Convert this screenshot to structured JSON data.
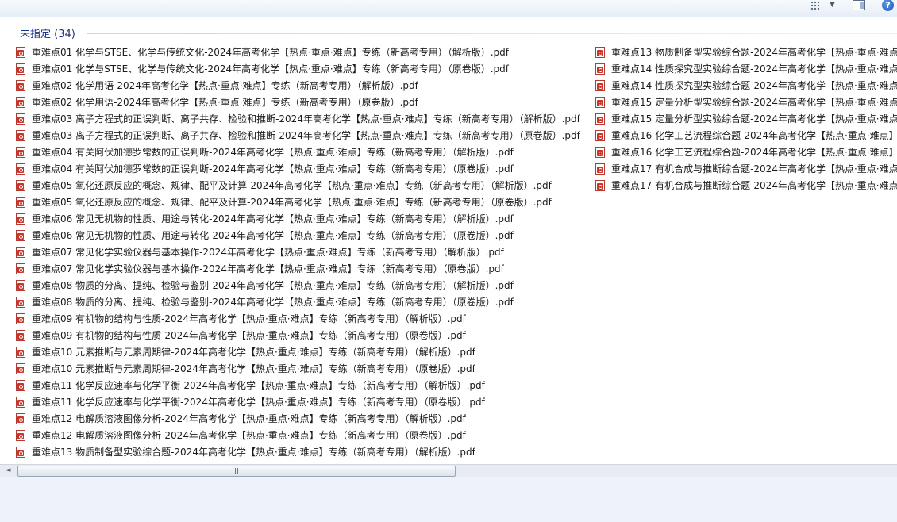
{
  "group": {
    "label": "未指定 (34)"
  },
  "colors": {
    "group_header": "#1e3287",
    "pdf_red": "#c9342b"
  },
  "icons": {
    "view": "view-options-icon",
    "chevron": "chevron-down-icon",
    "pane": "preview-pane-icon",
    "help": "help-icon",
    "file": "pdf-file-icon"
  },
  "toolbar": {
    "chevron_glyph": "▼",
    "help_glyph": "?"
  },
  "scroll": {
    "left_arrow": "◄"
  },
  "files_col1": [
    "重难点01 化学与STSE、化学与传统文化-2024年高考化学【热点·重点·难点】专练（新高考专用）（解析版）.pdf",
    "重难点01 化学与STSE、化学与传统文化-2024年高考化学【热点·重点·难点】专练（新高考专用）（原卷版）.pdf",
    "重难点02 化学用语-2024年高考化学【热点·重点·难点】专练（新高考专用）（解析版）.pdf",
    "重难点02 化学用语-2024年高考化学【热点·重点·难点】专练（新高考专用）（原卷版）.pdf",
    "重难点03 离子方程式的正误判断、离子共存、检验和推断-2024年高考化学【热点·重点·难点】专练（新高考专用）（解析版）.pdf",
    "重难点03 离子方程式的正误判断、离子共存、检验和推断-2024年高考化学【热点·重点·难点】专练（新高考专用）（原卷版）.pdf",
    "重难点04 有关阿伏加德罗常数的正误判断-2024年高考化学【热点·重点·难点】专练（新高考专用）（解析版）.pdf",
    "重难点04 有关阿伏加德罗常数的正误判断-2024年高考化学【热点·重点·难点】专练（新高考专用）（原卷版）.pdf",
    "重难点05 氧化还原反应的概念、规律、配平及计算-2024年高考化学【热点·重点·难点】专练（新高考专用）（解析版）.pdf",
    "重难点05 氧化还原反应的概念、规律、配平及计算-2024年高考化学【热点·重点·难点】专练（新高考专用）（原卷版）.pdf",
    "重难点06 常见无机物的性质、用途与转化-2024年高考化学【热点·重点·难点】专练（新高考专用）（解析版）.pdf",
    "重难点06 常见无机物的性质、用途与转化-2024年高考化学【热点·重点·难点】专练（新高考专用）（原卷版）.pdf",
    "重难点07 常见化学实验仪器与基本操作-2024年高考化学【热点·重点·难点】专练（新高考专用）（解析版）.pdf",
    "重难点07 常见化学实验仪器与基本操作-2024年高考化学【热点·重点·难点】专练（新高考专用）（原卷版）.pdf",
    "重难点08 物质的分离、提纯、检验与鉴别-2024年高考化学【热点·重点·难点】专练（新高考专用）（解析版）.pdf",
    "重难点08 物质的分离、提纯、检验与鉴别-2024年高考化学【热点·重点·难点】专练（新高考专用）（原卷版）.pdf",
    "重难点09 有机物的结构与性质-2024年高考化学【热点·重点·难点】专练（新高考专用）（解析版）.pdf",
    "重难点09 有机物的结构与性质-2024年高考化学【热点·重点·难点】专练（新高考专用）（原卷版）.pdf",
    "重难点10 元素推断与元素周期律-2024年高考化学【热点·重点·难点】专练（新高考专用）（解析版）.pdf",
    "重难点10 元素推断与元素周期律-2024年高考化学【热点·重点·难点】专练（新高考专用）（原卷版）.pdf",
    "重难点11 化学反应速率与化学平衡-2024年高考化学【热点·重点·难点】专练（新高考专用）（解析版）.pdf",
    "重难点11 化学反应速率与化学平衡-2024年高考化学【热点·重点·难点】专练（新高考专用）（原卷版）.pdf",
    "重难点12 电解质溶液图像分析-2024年高考化学【热点·重点·难点】专练（新高考专用）（解析版）.pdf",
    "重难点12 电解质溶液图像分析-2024年高考化学【热点·重点·难点】专练（新高考专用）（原卷版）.pdf",
    "重难点13 物质制备型实验综合题-2024年高考化学【热点·重点·难点】专练（新高考专用）（解析版）.pdf"
  ],
  "files_col2": [
    "重难点13 物质制备型实验综合题-2024年高考化学【热点·重点·难点】",
    "重难点14 性质探究型实验综合题-2024年高考化学【热点·重点·难点】",
    "重难点14 性质探究型实验综合题-2024年高考化学【热点·重点·难点】",
    "重难点15 定量分析型实验综合题-2024年高考化学【热点·重点·难点】",
    "重难点15 定量分析型实验综合题-2024年高考化学【热点·重点·难点】",
    "重难点16 化学工艺流程综合题-2024年高考化学【热点·重点·难点】专",
    "重难点16 化学工艺流程综合题-2024年高考化学【热点·重点·难点】专",
    "重难点17 有机合成与推断综合题-2024年高考化学【热点·重点·难点】",
    "重难点17 有机合成与推断综合题-2024年高考化学【热点·重点·难点】"
  ]
}
